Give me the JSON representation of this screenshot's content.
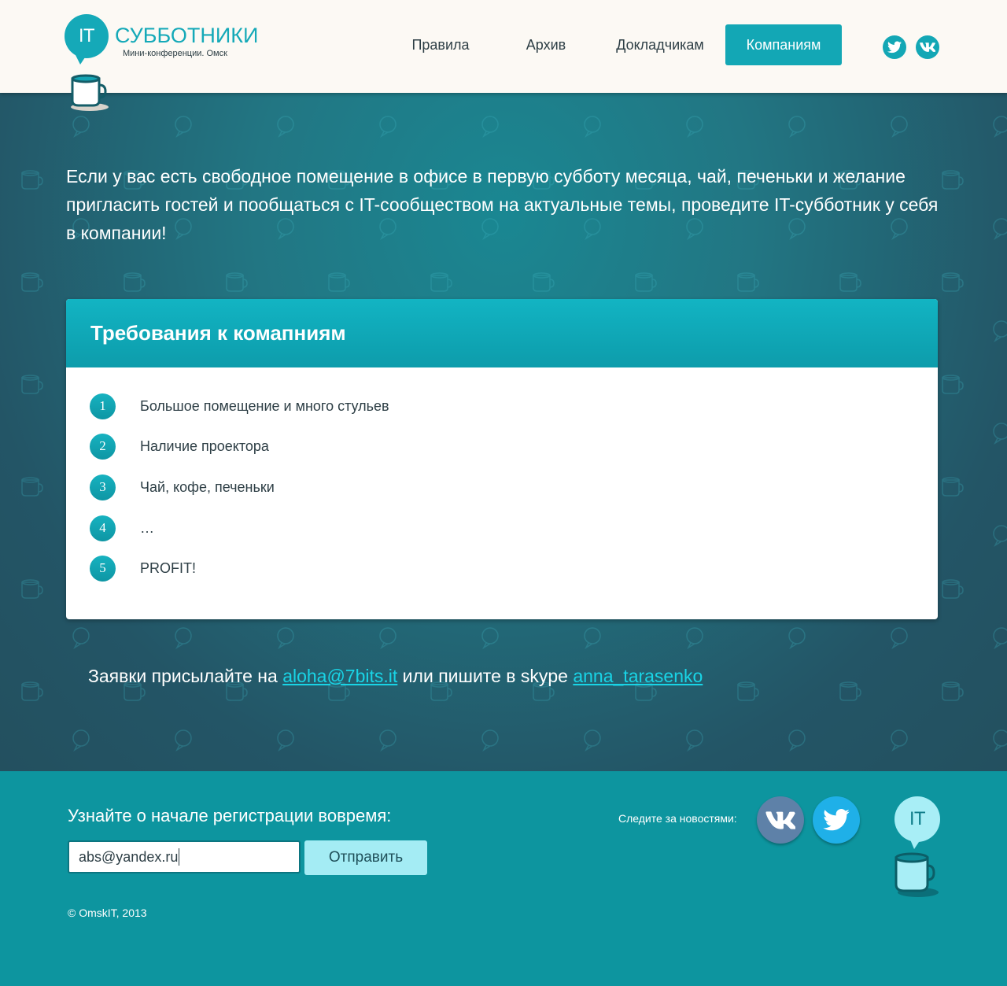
{
  "header": {
    "logo": {
      "bubble_text": "IT",
      "title": "СУББОТНИКИ",
      "subtitle": "Мини-конференции. Омск"
    },
    "nav": [
      {
        "label": "Правила",
        "active": false
      },
      {
        "label": "Архив",
        "active": false
      },
      {
        "label": "Докладчикам",
        "active": false
      },
      {
        "label": "Компаниям",
        "active": true
      }
    ],
    "social": [
      "twitter-icon",
      "vk-icon"
    ]
  },
  "main": {
    "intro": "Если у вас есть свободное помещение в офисе в первую субботу месяца, чай, печеньки и желание пригласить гостей и пообщаться с IT-сообществом на актуальные темы, проведите IT-субботник у себя в компании!",
    "requirements": {
      "title": "Требования к комапниям",
      "items": [
        {
          "num": "1",
          "text": "Большое помещение и много стульев"
        },
        {
          "num": "2",
          "text": "Наличие проектора"
        },
        {
          "num": "3",
          "text": "Чай, кофе, печеньки"
        },
        {
          "num": "4",
          "text": "…"
        },
        {
          "num": "5",
          "text": "PROFIT!"
        }
      ]
    },
    "contact": {
      "prefix": "Заявки присылайте на ",
      "email": "aloha@7bits.it",
      "middle": " или пишите в skype ",
      "skype": "anna_tarasenko"
    }
  },
  "footer": {
    "subscribe_label": "Узнайте о начале регистрации вовремя:",
    "email_value": "abs@yandex.ru",
    "submit_label": "Отправить",
    "copyright": "©  OmskIT, 2013",
    "follow_label": "Следите за новостями:",
    "logo_bubble_text": "IT"
  },
  "colors": {
    "accent": "#13a7b5",
    "header_bg": "#fcf9f4",
    "hero_dark": "#23505f",
    "footer_bg": "#0d959f",
    "link": "#19d4e6",
    "vk": "#5e81a8",
    "twitter": "#1fb0e8"
  }
}
